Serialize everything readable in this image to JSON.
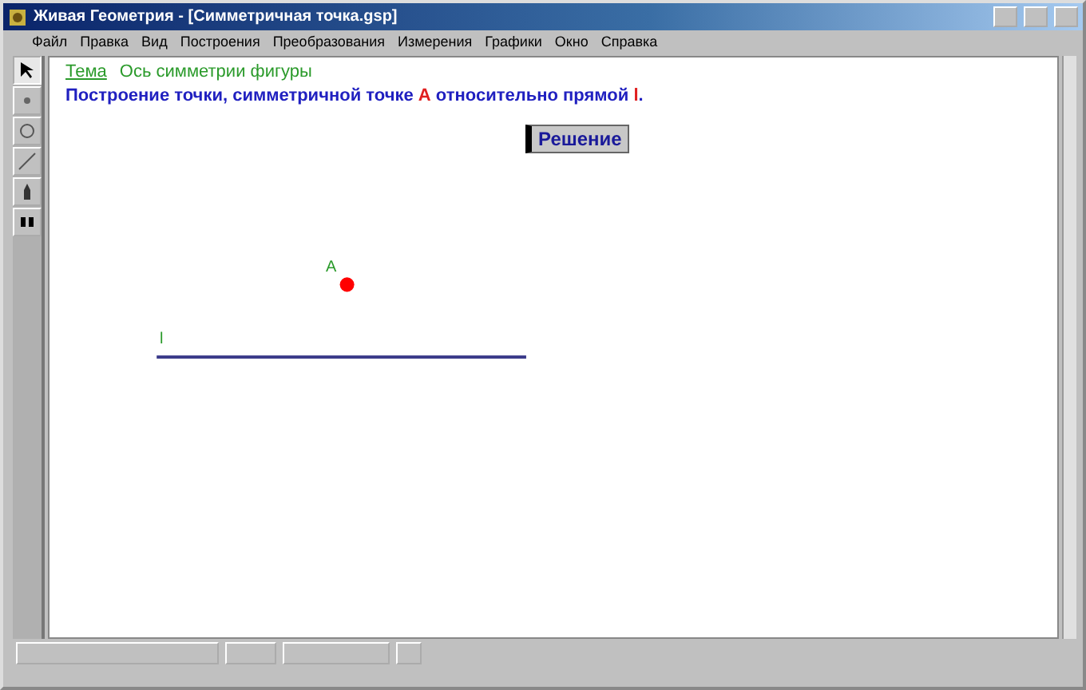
{
  "window": {
    "title": "Живая Геометрия - [Симметричная точка.gsp]"
  },
  "menu": [
    "Файл",
    "Правка",
    "Вид",
    "Построения",
    "Преобразования",
    "Измерения",
    "Графики",
    "Окно",
    "Справка"
  ],
  "tools": [
    {
      "kind": "arrow",
      "selected": true
    },
    {
      "kind": "point",
      "selected": false
    },
    {
      "kind": "circle",
      "selected": false
    },
    {
      "kind": "line",
      "selected": false
    },
    {
      "kind": "text",
      "selected": false
    },
    {
      "kind": "script",
      "selected": false
    }
  ],
  "sketch": {
    "topic_link": "Тема",
    "topic": "Ось симметрии фигуры",
    "task": "Построение точки, симметричной точке **A** относительно прямой **l**.",
    "solution_button": "Решение",
    "point_label": "A",
    "line_label": "l"
  }
}
